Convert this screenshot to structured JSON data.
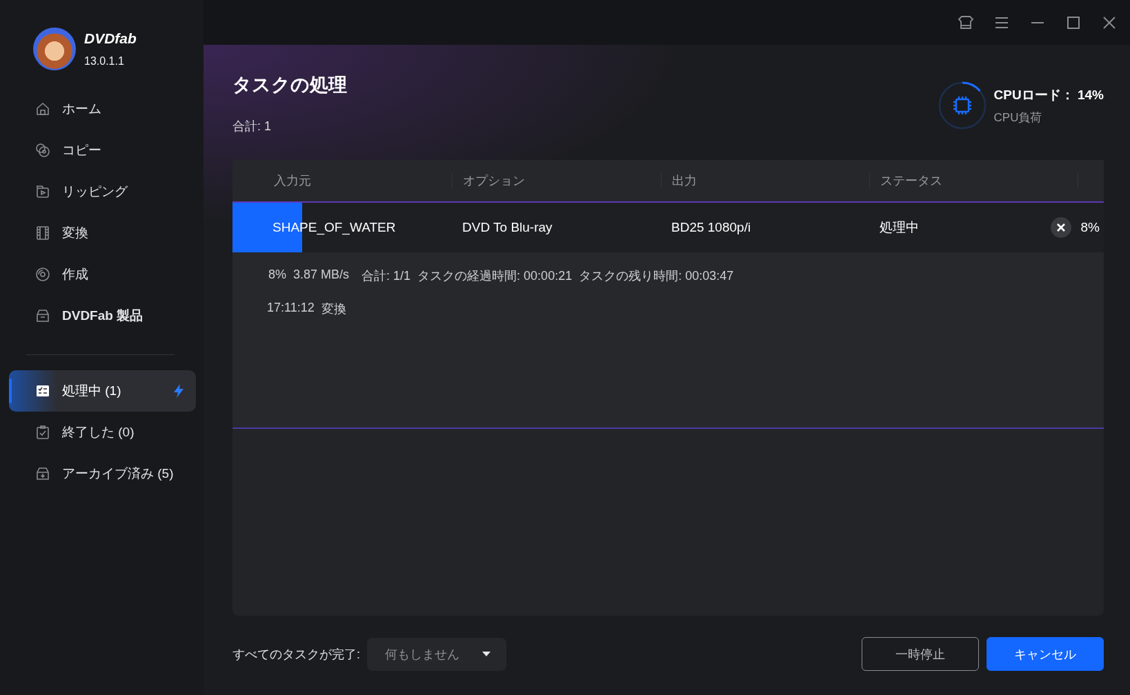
{
  "app": {
    "name": "DVDfab",
    "version": "13.0.1.1"
  },
  "sidebar": {
    "items": [
      {
        "label": "ホーム",
        "kind": "module",
        "selected": false
      },
      {
        "label": "コピー",
        "kind": "module",
        "selected": false
      },
      {
        "label": "リッピング",
        "kind": "module",
        "selected": false
      },
      {
        "label": "変換",
        "kind": "module",
        "selected": false
      },
      {
        "label": "作成",
        "kind": "module",
        "selected": false
      },
      {
        "label": "DVDFab 製品",
        "kind": "product",
        "selected": false
      }
    ],
    "queue_items": [
      {
        "label": "処理中 (1)",
        "selected": true,
        "running": true
      },
      {
        "label": "終了した (0)",
        "selected": false,
        "running": false
      },
      {
        "label": "アーカイブ済み (5)",
        "selected": false,
        "running": false
      }
    ]
  },
  "page": {
    "title": "タスクの処理",
    "total": "合計: 1"
  },
  "cpu": {
    "label": "CPUロード：",
    "value": "14%",
    "caption": "CPU負荷",
    "level": 0.14
  },
  "table": {
    "columns": [
      "入力元",
      "オプション",
      "出力",
      "ステータス"
    ],
    "rows": [
      {
        "input": "SHAPE_OF_WATER",
        "option": "DVD To Blu-ray",
        "output": "BD25 1080p/i",
        "status": "処理中",
        "level": 0.08,
        "percent": "8%",
        "details": [
          "8%",
          "3.87 MB/s",
          "合計: 1/1",
          "タスクの経過時間: 00:00:21",
          "タスクの残り時間: 00:03:47"
        ],
        "log": [
          "17:11:12",
          "変換"
        ]
      }
    ]
  },
  "footer": {
    "label": "すべてのタスクが完了:",
    "select": {
      "value": "何もしません"
    },
    "buttons": [
      {
        "label": "一時停止",
        "kind": "secondary"
      },
      {
        "label": "キャンセル",
        "kind": "primary"
      }
    ]
  }
}
